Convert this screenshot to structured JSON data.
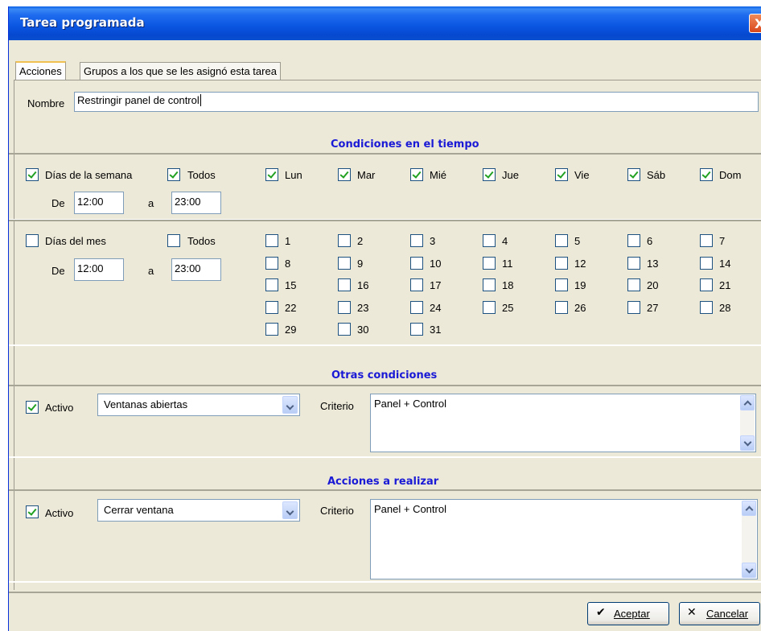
{
  "window": {
    "title": "Tarea programada",
    "close_glyph": "X"
  },
  "tabs": [
    {
      "label": "Acciones"
    },
    {
      "label": "Grupos a los que se les asignó esta tarea"
    }
  ],
  "nombre": {
    "label": "Nombre",
    "value": "Restringir panel de control"
  },
  "time_conditions": {
    "header": "Condiciones en el tiempo",
    "week": {
      "label": "Días de la semana",
      "checked": true,
      "all_label": "Todos",
      "all_checked": true,
      "days": [
        {
          "label": "Lun",
          "checked": true
        },
        {
          "label": "Mar",
          "checked": true
        },
        {
          "label": "Mié",
          "checked": true
        },
        {
          "label": "Jue",
          "checked": true
        },
        {
          "label": "Vie",
          "checked": true
        },
        {
          "label": "Sáb",
          "checked": true
        },
        {
          "label": "Dom",
          "checked": true
        }
      ],
      "from_label": "De",
      "from_value": "12:00",
      "to_label": "a",
      "to_value": "23:00"
    },
    "month": {
      "label": "Días del mes",
      "checked": false,
      "all_label": "Todos",
      "all_checked": false,
      "days": [
        "1",
        "2",
        "3",
        "4",
        "5",
        "6",
        "7",
        "8",
        "9",
        "10",
        "11",
        "12",
        "13",
        "14",
        "15",
        "16",
        "17",
        "18",
        "19",
        "20",
        "21",
        "22",
        "23",
        "24",
        "25",
        "26",
        "27",
        "28",
        "29",
        "30",
        "31"
      ],
      "from_label": "De",
      "from_value": "12:00",
      "to_label": "a",
      "to_value": "23:00"
    }
  },
  "other_conditions": {
    "header": "Otras condiciones",
    "active_label": "Activo",
    "active_checked": true,
    "selected": "Ventanas abiertas",
    "criterio_label": "Criterio",
    "criterio_value": "Panel + Control"
  },
  "actions": {
    "header": "Acciones a realizar",
    "active_label": "Activo",
    "active_checked": true,
    "selected": "Cerrar ventana",
    "criterio_label": "Criterio",
    "criterio_value": "Panel + Control"
  },
  "buttons": {
    "accept": "Aceptar",
    "cancel": "Cancelar"
  },
  "icons": {
    "accept": "checkmark-icon",
    "cancel": "x-icon",
    "close": "close-icon"
  },
  "colors": {
    "titlebar": "#0a55e0",
    "header": "#1a1ad6",
    "check": "#21a121",
    "window_bg": "#ece9d8"
  }
}
